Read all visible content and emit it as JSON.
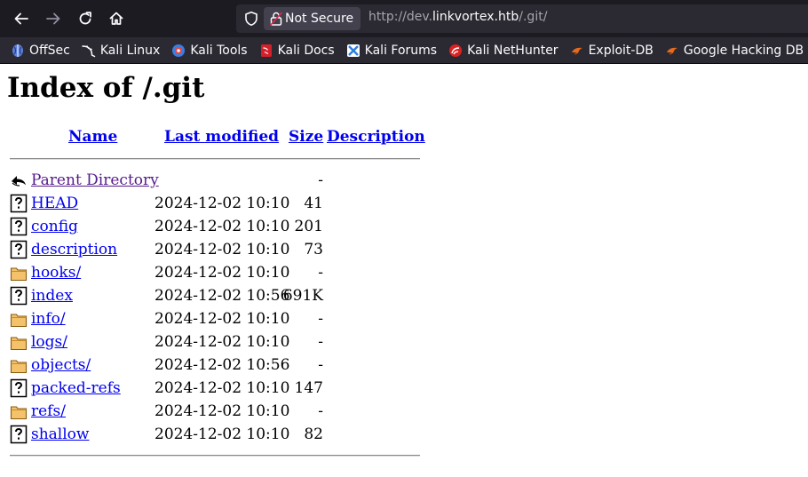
{
  "browser": {
    "security_label": "Not Secure",
    "url_prefix": "http://dev.",
    "url_host": "linkvortex.htb",
    "url_path": "/.git/"
  },
  "bookmarks": [
    {
      "label": "OffSec",
      "icon": "offsec-icon",
      "color": "#4f8ef7"
    },
    {
      "label": "Kali Linux",
      "icon": "kali-dragon-icon",
      "color": "#ffffff"
    },
    {
      "label": "Kali Tools",
      "icon": "kali-tools-icon",
      "color": "#3d7de0"
    },
    {
      "label": "Kali Docs",
      "icon": "kali-docs-icon",
      "color": "#d4202b"
    },
    {
      "label": "Kali Forums",
      "icon": "kali-forums-icon",
      "color": "#2b7de0"
    },
    {
      "label": "Kali NetHunter",
      "icon": "kali-nethunter-icon",
      "color": "#e02020"
    },
    {
      "label": "Exploit-DB",
      "icon": "exploit-db-icon",
      "color": "#e86a1a"
    },
    {
      "label": "Google Hacking DB",
      "icon": "ghdb-icon",
      "color": "#e86a1a"
    }
  ],
  "page": {
    "title": "Index of /.git",
    "columns": {
      "name": "Name",
      "last_modified": "Last modified",
      "size": "Size",
      "description": "Description"
    },
    "parent": {
      "name": "Parent Directory",
      "date": "",
      "size": "-"
    },
    "entries": [
      {
        "name": "HEAD",
        "date": "2024-12-02 10:10",
        "size": "41",
        "type": "file"
      },
      {
        "name": "config",
        "date": "2024-12-02 10:10",
        "size": "201",
        "type": "file"
      },
      {
        "name": "description",
        "date": "2024-12-02 10:10",
        "size": "73",
        "type": "file"
      },
      {
        "name": "hooks/",
        "date": "2024-12-02 10:10",
        "size": "-",
        "type": "folder"
      },
      {
        "name": "index",
        "date": "2024-12-02 10:56",
        "size": "691K",
        "type": "file"
      },
      {
        "name": "info/",
        "date": "2024-12-02 10:10",
        "size": "-",
        "type": "folder"
      },
      {
        "name": "logs/",
        "date": "2024-12-02 10:10",
        "size": "-",
        "type": "folder"
      },
      {
        "name": "objects/",
        "date": "2024-12-02 10:56",
        "size": "-",
        "type": "folder"
      },
      {
        "name": "packed-refs",
        "date": "2024-12-02 10:10",
        "size": "147",
        "type": "file"
      },
      {
        "name": "refs/",
        "date": "2024-12-02 10:10",
        "size": "-",
        "type": "folder"
      },
      {
        "name": "shallow",
        "date": "2024-12-02 10:10",
        "size": "82",
        "type": "file"
      }
    ]
  }
}
